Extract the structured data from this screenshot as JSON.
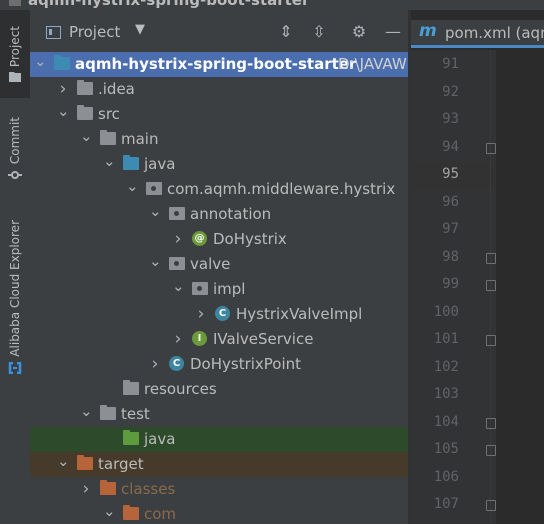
{
  "window": {
    "title": "aqmh-hystrix-spring-boot-starter"
  },
  "side_tabs": [
    {
      "label": "Project",
      "icon": "folder-icon"
    },
    {
      "label": "Commit",
      "icon": "commit-icon"
    },
    {
      "label": "Alibaba Cloud Explorer",
      "icon": "alibaba-cloud-icon"
    }
  ],
  "project_panel": {
    "title": "Project",
    "toolbar": [
      "expand-all-icon",
      "collapse-all-icon",
      "gear-icon",
      "minimize-icon"
    ],
    "tree": [
      {
        "label": "aqmh-hystrix-spring-boot-starter",
        "path": "D:\\JAVAW",
        "depth": 0,
        "expanded": true,
        "icon": "module-folder",
        "selected": true
      },
      {
        "label": ".idea",
        "depth": 1,
        "expanded": false,
        "icon": "folder"
      },
      {
        "label": "src",
        "depth": 1,
        "expanded": true,
        "icon": "folder"
      },
      {
        "label": "main",
        "depth": 2,
        "expanded": true,
        "icon": "folder"
      },
      {
        "label": "java",
        "depth": 3,
        "expanded": true,
        "icon": "source-folder"
      },
      {
        "label": "com.aqmh.middleware.hystrix",
        "depth": 4,
        "expanded": true,
        "icon": "package"
      },
      {
        "label": "annotation",
        "depth": 5,
        "expanded": true,
        "icon": "package"
      },
      {
        "label": "DoHystrix",
        "depth": 6,
        "expanded": false,
        "icon": "annotation"
      },
      {
        "label": "valve",
        "depth": 5,
        "expanded": true,
        "icon": "package"
      },
      {
        "label": "impl",
        "depth": 6,
        "expanded": true,
        "icon": "package"
      },
      {
        "label": "HystrixValveImpl",
        "depth": 7,
        "expanded": false,
        "icon": "class"
      },
      {
        "label": "IValveService",
        "depth": 6,
        "expanded": false,
        "icon": "interface"
      },
      {
        "label": "DoHystrixPoint",
        "depth": 5,
        "expanded": false,
        "icon": "class"
      },
      {
        "label": "resources",
        "depth": 3,
        "icon": "resources-folder"
      },
      {
        "label": "test",
        "depth": 2,
        "expanded": true,
        "icon": "folder"
      },
      {
        "label": "java",
        "depth": 3,
        "icon": "test-folder",
        "highlight": "green"
      },
      {
        "label": "target",
        "depth": 1,
        "expanded": true,
        "icon": "excluded-folder",
        "highlight": "brown"
      },
      {
        "label": "classes",
        "depth": 2,
        "expanded": false,
        "icon": "excluded-folder",
        "dim": true
      },
      {
        "label": "com",
        "depth": 3,
        "expanded": true,
        "icon": "excluded-folder",
        "dim": true
      }
    ]
  },
  "editor": {
    "tab_icon": "m",
    "tab_label": "pom.xml (aqm",
    "line_numbers": [
      "91",
      "92",
      "93",
      "94",
      "95",
      "96",
      "97",
      "98",
      "99",
      "100",
      "101",
      "102",
      "103",
      "104",
      "105",
      "106",
      "107"
    ],
    "current_line": "95"
  },
  "colors": {
    "selection": "#4b6eaf",
    "panel_bg": "#3c3f41",
    "editor_bg": "#2b2b2b",
    "test_folder": "#5d9b3e",
    "excluded_folder": "#b8643a"
  }
}
